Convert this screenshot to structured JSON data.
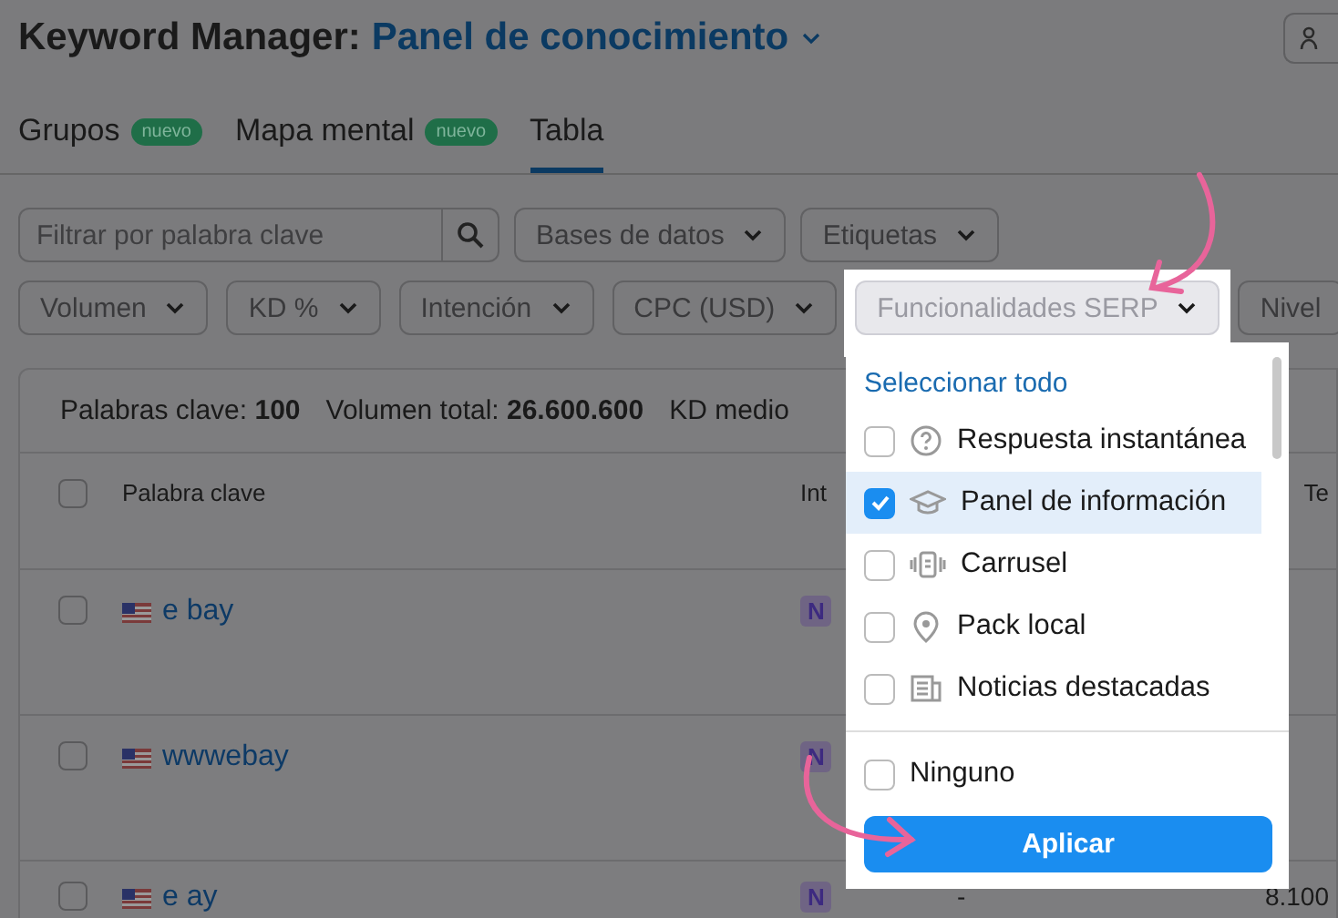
{
  "header": {
    "title": "Keyword Manager:",
    "project": "Panel de conocimiento"
  },
  "tabs": [
    {
      "label": "Grupos",
      "badge": "nuevo",
      "selected": false
    },
    {
      "label": "Mapa mental",
      "badge": "nuevo",
      "selected": false
    },
    {
      "label": "Tabla",
      "selected": true
    }
  ],
  "filters": {
    "search": {
      "placeholder": "Filtrar por palabra clave"
    },
    "row_1": [
      {
        "label": "Bases de datos",
        "expanded": false
      },
      {
        "label": "Etiquetas",
        "expanded": false
      }
    ],
    "row_2": [
      {
        "label": "Volumen",
        "expanded": false
      },
      {
        "label": "KD %",
        "expanded": false
      },
      {
        "label": "Intención",
        "expanded": false
      },
      {
        "label": "CPC (USD)",
        "expanded": false
      },
      {
        "label": "Funcionalidades SERP",
        "expanded": true
      },
      {
        "label": "Nivel",
        "expanded": false
      }
    ]
  },
  "summary": [
    "Palabras clave: **100**",
    "Volumen total: **26.600.600**",
    "KD medio"
  ],
  "table": {
    "all_checked": false,
    "columns": [
      "Palabra clave",
      "Int",
      "Te"
    ],
    "rows": [
      {
        "keyword": "e bay",
        "intent": "N",
        "checked": false
      },
      {
        "keyword": "wwwebay",
        "intent": "N",
        "checked": false
      },
      {
        "keyword": "e ay",
        "intent": "N",
        "checked": false,
        "column_4": "-",
        "column_5": "8.100"
      }
    ]
  },
  "dropdown": {
    "select_all": "Seleccionar todo",
    "options": [
      {
        "label": "Respuesta instantánea",
        "kind": "question",
        "checked": false
      },
      {
        "label": "Panel de información",
        "kind": "cap",
        "checked": true
      },
      {
        "label": "Carrusel",
        "kind": "carousel",
        "checked": false
      },
      {
        "label": "Pack local",
        "kind": "pin",
        "checked": false
      },
      {
        "label": "Noticias destacadas",
        "kind": "news",
        "checked": false
      }
    ],
    "none": {
      "label": "Ninguno",
      "checked": false
    },
    "apply": "Aplicar"
  }
}
